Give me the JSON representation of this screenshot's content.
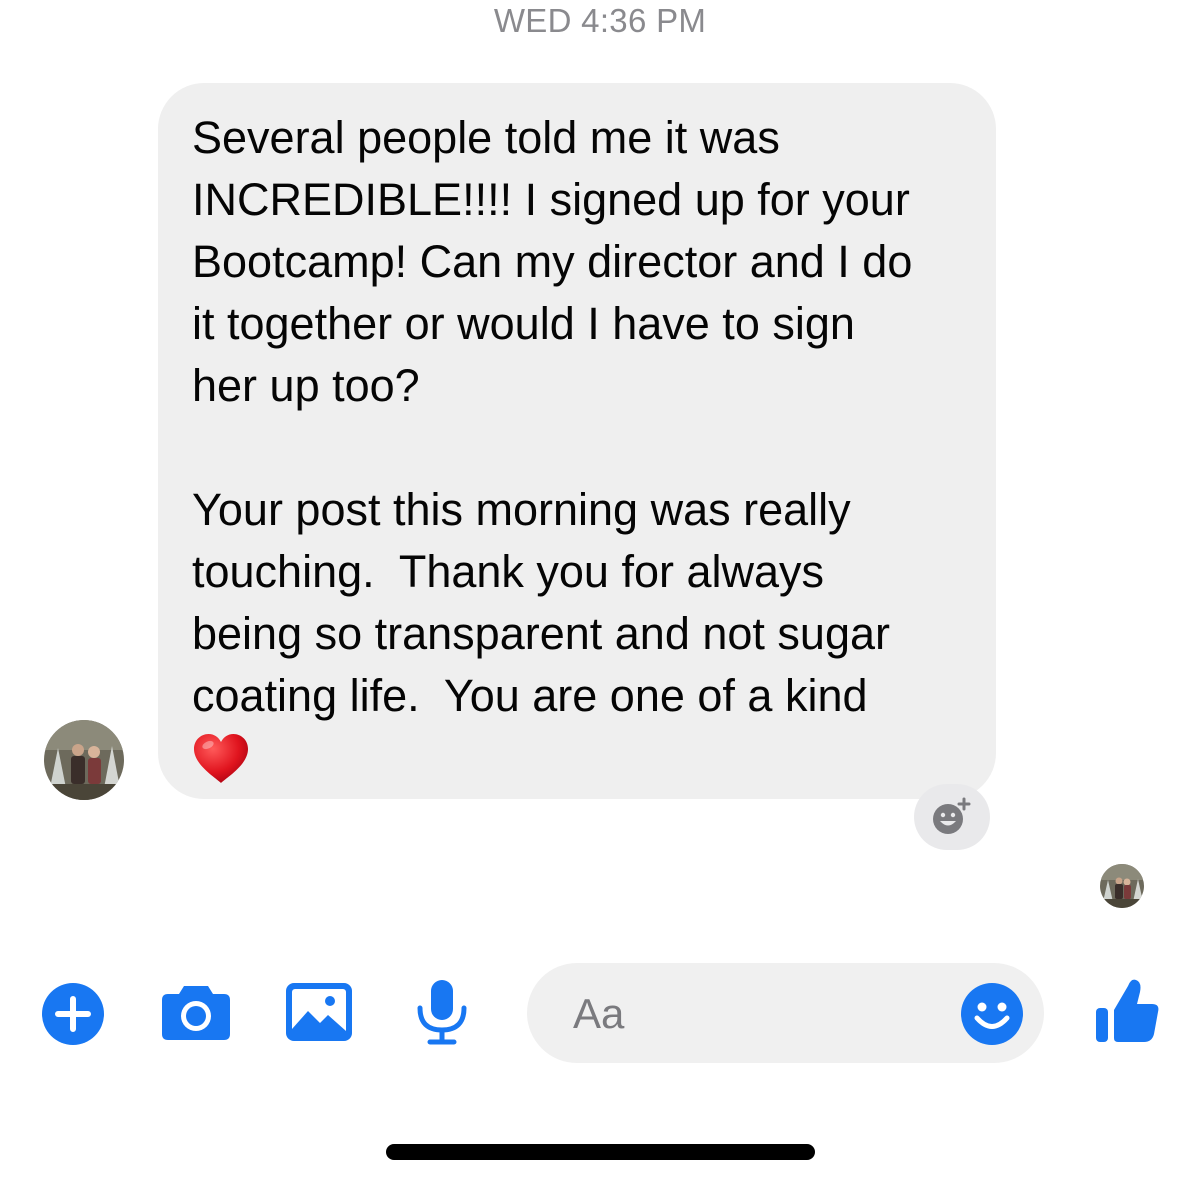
{
  "conversation": {
    "timestamp": "WED 4:36 PM",
    "message": {
      "paragraph_1": "Several people told me it was\nINCREDIBLE!!!! I signed up for your\nBootcamp! Can my director and I do\nit together or would I have to sign\nher up too?",
      "paragraph_2": "Your post this morning was really\ntouching.  Thank you for always\nbeing so transparent and not sugar\ncoating life.  You are one of a kind",
      "emoji": "heart"
    }
  },
  "composer": {
    "placeholder": "Aa"
  },
  "icons": {
    "plus": "plus-circle-icon",
    "camera": "camera-icon",
    "gallery": "image-icon",
    "mic": "microphone-icon",
    "emoji": "smiley-icon",
    "like": "thumbs-up-icon",
    "react": "add-reaction-icon"
  },
  "colors": {
    "accent": "#1877f2",
    "bubble": "#efefef",
    "timestamp": "#8a8a8e"
  }
}
